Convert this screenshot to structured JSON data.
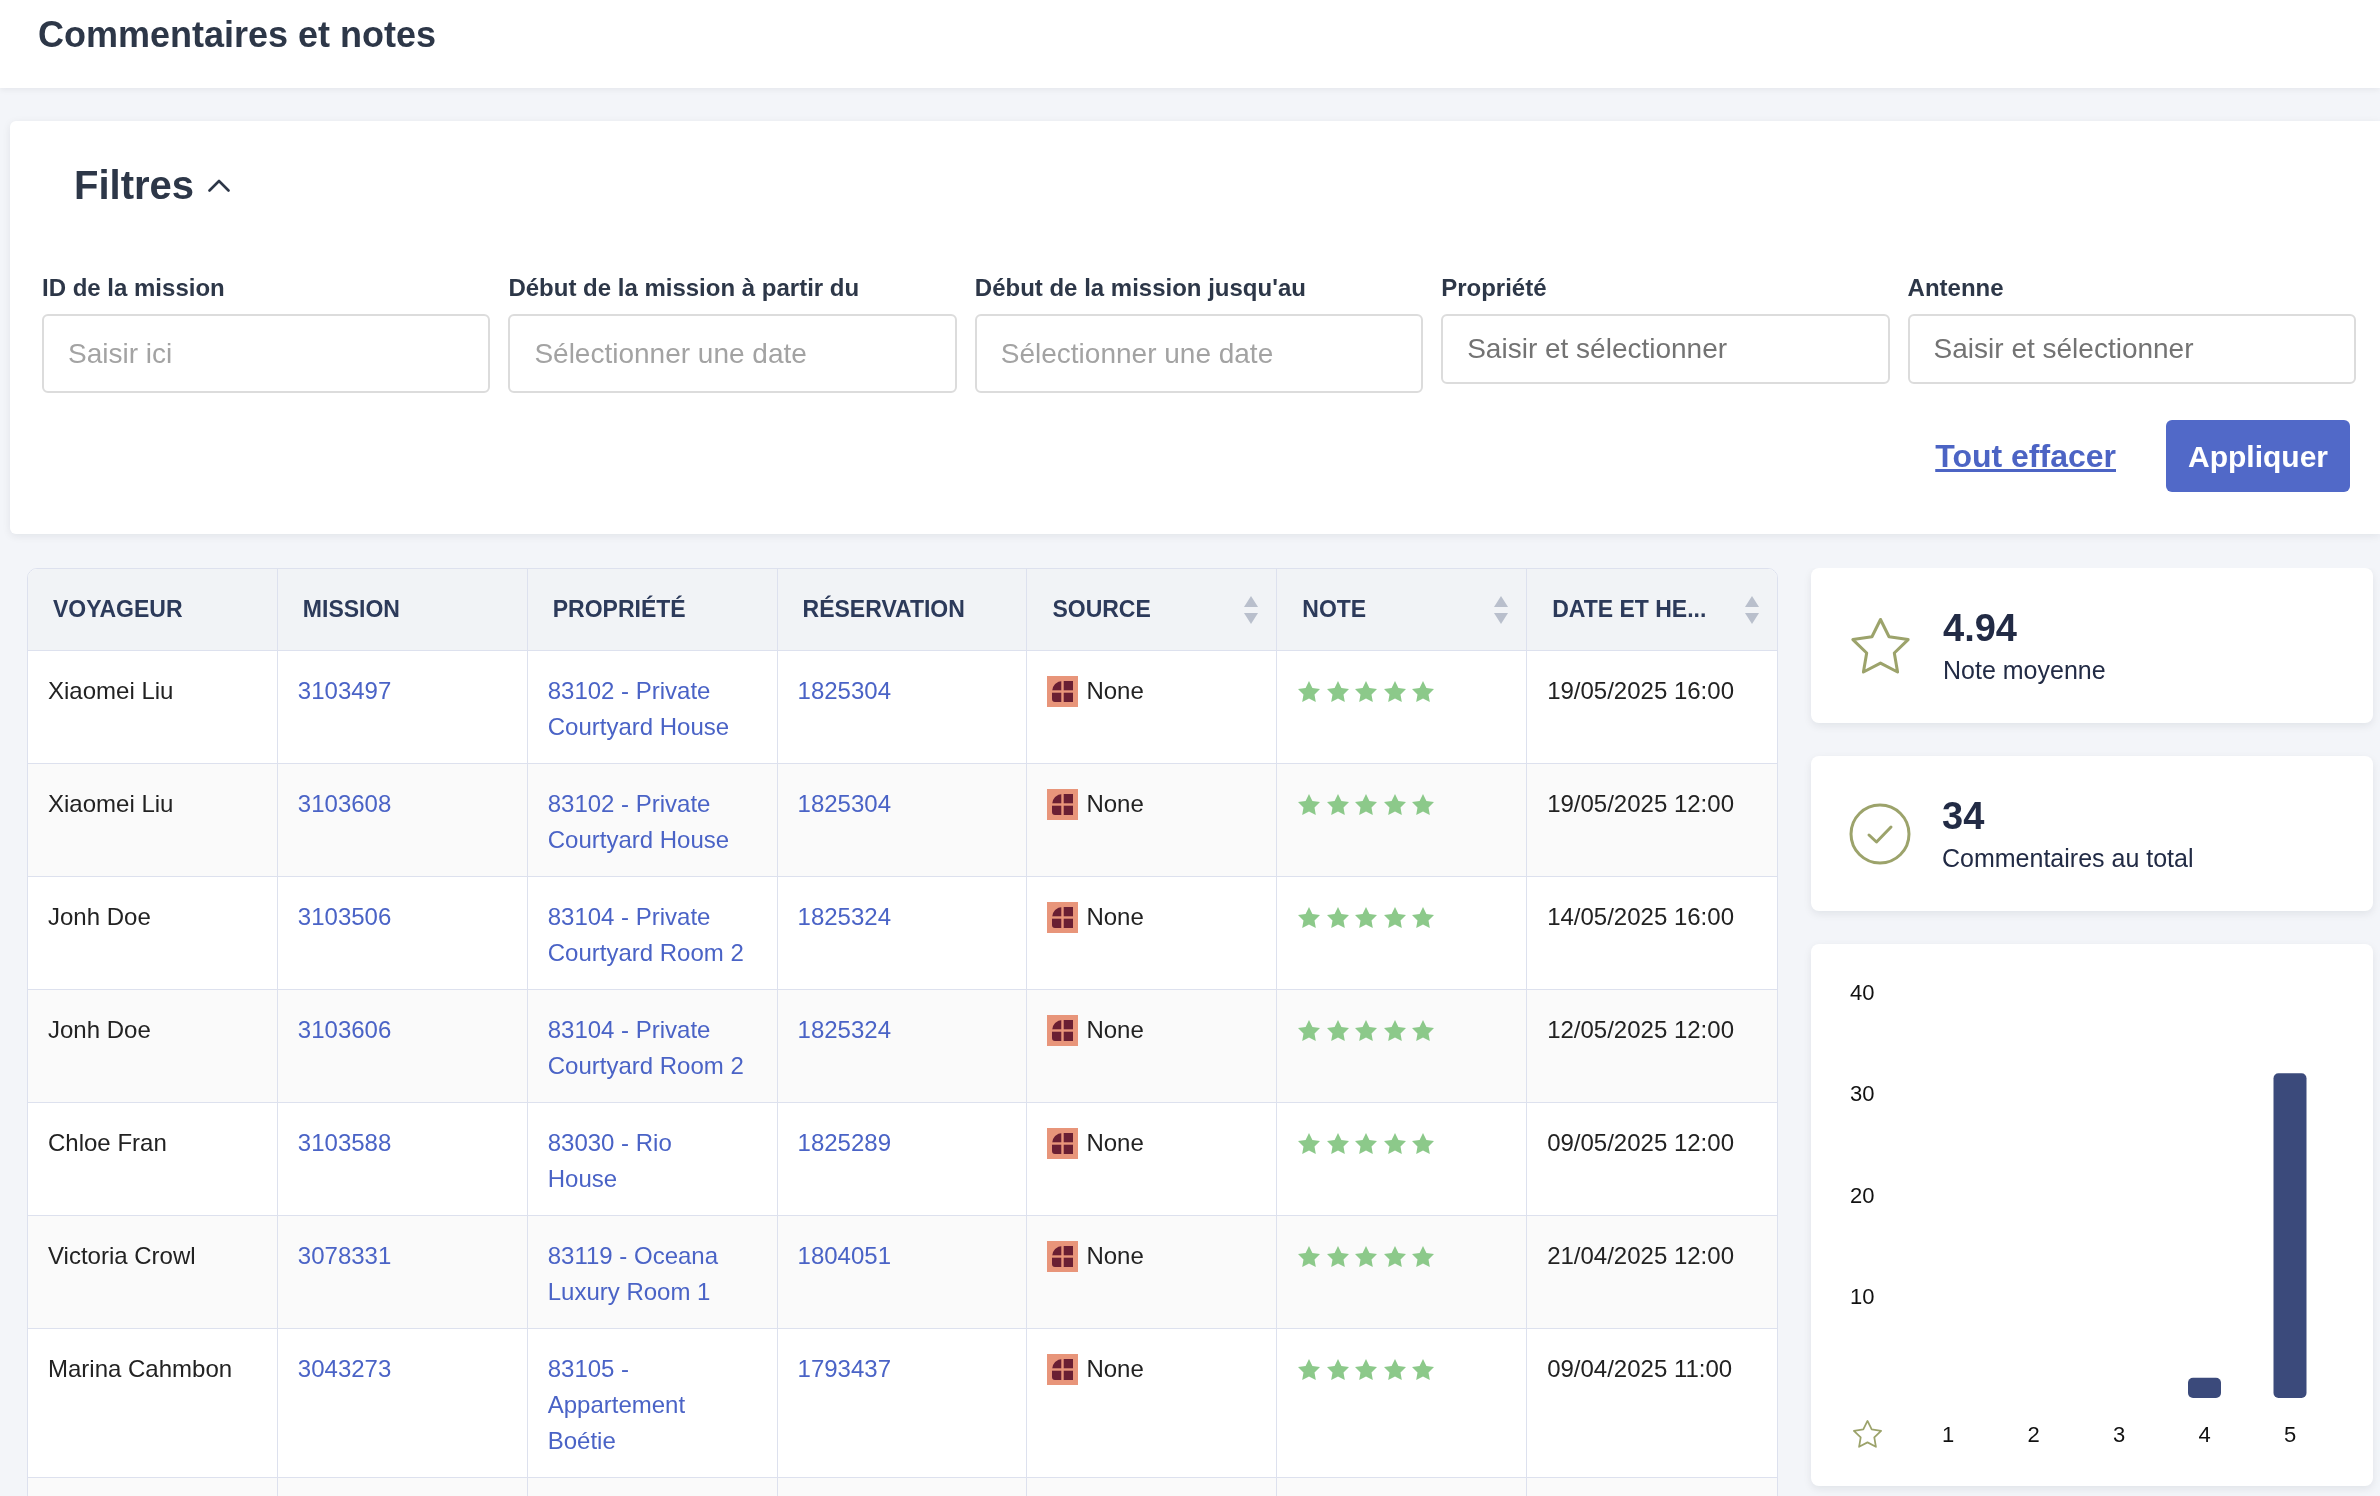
{
  "header": {
    "title": "Commentaires et notes"
  },
  "filters": {
    "title": "Filtres",
    "expanded": true,
    "fields": [
      {
        "kind": "text",
        "label": "ID de la mission",
        "placeholder": "Saisir ici"
      },
      {
        "kind": "date",
        "label": "Début de la mission à partir du",
        "placeholder": "Sélectionner une date"
      },
      {
        "kind": "date",
        "label": "Début de la mission jusqu'au",
        "placeholder": "Sélectionner une date"
      },
      {
        "kind": "select",
        "label": "Propriété",
        "placeholder": "Saisir et sélectionner"
      },
      {
        "kind": "select",
        "label": "Antenne",
        "placeholder": "Saisir et sélectionner"
      }
    ],
    "clear_link": "Tout effacer",
    "apply_button": "Appliquer"
  },
  "table": {
    "columns": [
      {
        "label": "VOYAGEUR",
        "sortable": false
      },
      {
        "label": "MISSION",
        "sortable": false
      },
      {
        "label": "PROPRIÉTÉ",
        "sortable": false
      },
      {
        "label": "RÉSERVATION",
        "sortable": false
      },
      {
        "label": "SOURCE",
        "sortable": true
      },
      {
        "label": "NOTE",
        "sortable": true
      },
      {
        "label": "DATE ET HE...",
        "sortable": true
      }
    ],
    "rows": [
      {
        "traveler": "Xiaomei Liu",
        "mission": "3103497",
        "property": "83102 - Private Courtyard House",
        "reservation": "1825304",
        "source": "None",
        "stars": 5,
        "date": "19/05/2025 16:00"
      },
      {
        "traveler": "Xiaomei Liu",
        "mission": "3103608",
        "property": "83102 - Private Courtyard House",
        "reservation": "1825304",
        "source": "None",
        "stars": 5,
        "date": "19/05/2025 12:00"
      },
      {
        "traveler": "Jonh Doe",
        "mission": "3103506",
        "property": "83104 - Private Courtyard Room 2",
        "reservation": "1825324",
        "source": "None",
        "stars": 5,
        "date": "14/05/2025 16:00"
      },
      {
        "traveler": "Jonh Doe",
        "mission": "3103606",
        "property": "83104 - Private Courtyard Room 2",
        "reservation": "1825324",
        "source": "None",
        "stars": 5,
        "date": "12/05/2025 12:00"
      },
      {
        "traveler": "Chloe Fran",
        "mission": "3103588",
        "property": "83030 - Rio House",
        "reservation": "1825289",
        "source": "None",
        "stars": 5,
        "date": "09/05/2025 12:00"
      },
      {
        "traveler": "Victoria Crowl",
        "mission": "3078331",
        "property": "83119 - Oceana Luxury Room 1",
        "reservation": "1804051",
        "source": "None",
        "stars": 5,
        "date": "21/04/2025 12:00"
      },
      {
        "traveler": "Marina Cahmbon",
        "mission": "3043273",
        "property": "83105 - Appartement Boétie",
        "reservation": "1793437",
        "source": "None",
        "stars": 5,
        "date": "09/04/2025 11:00"
      }
    ]
  },
  "stats": [
    {
      "kind": "rating",
      "value": "4.94",
      "label": "Note moyenne"
    },
    {
      "kind": "total",
      "value": "34",
      "label": "Commentaires au total"
    }
  ],
  "distribution": {
    "chart_data": {
      "type": "bar",
      "categories": [
        "1",
        "2",
        "3",
        "4",
        "5"
      ],
      "values": [
        0,
        0,
        0,
        2,
        32
      ],
      "ylim": [
        0,
        40
      ],
      "yticks": [
        10,
        20,
        30,
        40
      ]
    }
  }
}
